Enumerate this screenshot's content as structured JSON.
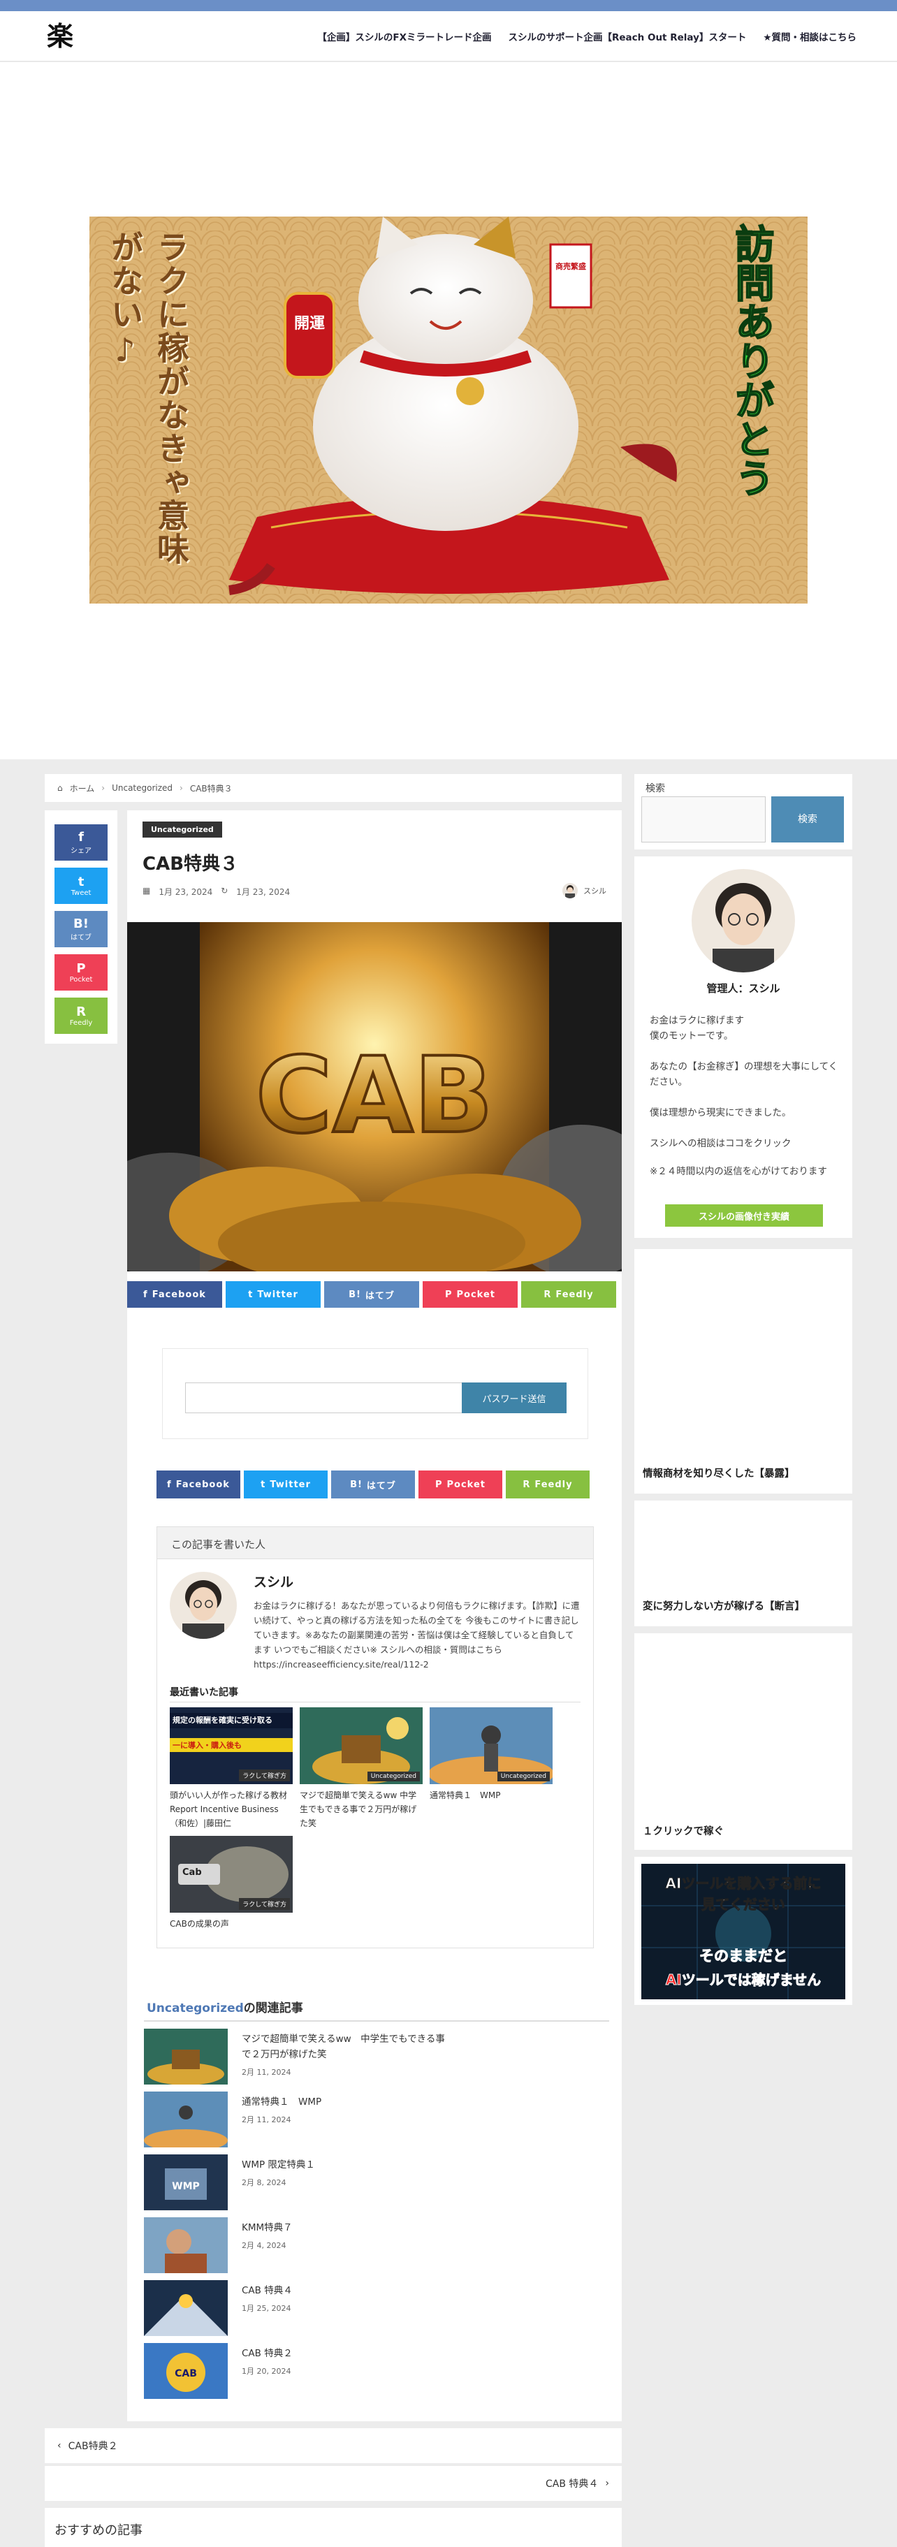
{
  "header": {
    "logo_char": "楽",
    "nav": [
      "【企画】スシルのFXミラートレード企画",
      "スシルのサポート企画【Reach Out Relay】スタート",
      "★質問・相談はこちら"
    ]
  },
  "hero": {
    "left_text": "ラクに稼がなきゃ意味がない♪",
    "right_text": "訪問ありがとう",
    "charm_left": "開運",
    "charm_right": "商売繁盛"
  },
  "breadcrumb": [
    "ホーム",
    "Uncategorized",
    "CAB特典３"
  ],
  "share_float": [
    {
      "icon": "f",
      "label": "シェア",
      "color": "#3b5998"
    },
    {
      "icon": "t",
      "label": "Tweet",
      "color": "#1da1f2"
    },
    {
      "icon": "B!",
      "label": "はてブ",
      "color": "#5d8ac1"
    },
    {
      "icon": "P",
      "label": "Pocket",
      "color": "#ef4056"
    },
    {
      "icon": "R",
      "label": "Feedly",
      "color": "#87c040"
    }
  ],
  "article": {
    "category": "Uncategorized",
    "title": "CAB特典３",
    "published": "1月 23, 2024",
    "updated": "1月 23, 2024",
    "author": "スシル",
    "eyecatch_text": "CAB"
  },
  "share_buttons": [
    "Facebook",
    "Twitter",
    "はてブ",
    "Pocket",
    "Feedly"
  ],
  "password_form": {
    "button": "パスワード送信"
  },
  "author_box": {
    "heading": "この記事を書いた人",
    "name": "スシル",
    "description": "お金はラクに稼げる！あなたが思っているより何倍もラクに稼げます。【詐欺】に遭い続けて、やっと真の稼げる方法を知った私の全てを 今後もこのサイトに書き記していきます。※あなたの副業関連の苦労・苦悩は僕は全て経験していると自負してます いつでもご相談ください※ スシルへの相談・質問はこちら https://increaseefficiency.site/real/112-2",
    "recent_heading": "最近書いた記事",
    "recent": [
      {
        "title": "頭がいい人が作った稼げる教材Report Incentive Business（和佐）|藤田仁",
        "tag": "ラクして稼ぎ方",
        "banner": "規定の報酬を確実に受け取る",
        "banner2": "一に導入・購入後も"
      },
      {
        "title": "マジで超簡単で笑えるww 中学生でもできる事で２万円が稼げた笑",
        "tag": "Uncategorized"
      },
      {
        "title": "通常特典１　WMP",
        "tag": "Uncategorized"
      },
      {
        "title": "CABの成果の声",
        "tag": "ラクして稼ぎ方",
        "logo": "Cab"
      }
    ]
  },
  "related": {
    "category": "Uncategorized",
    "suffix": "の関連記事",
    "items": [
      {
        "title": "マジで超簡単で笑えるww　中学生でもできる事で２万円が稼げた笑",
        "date": "2月 11, 2024"
      },
      {
        "title": "通常特典１　WMP",
        "date": "2月 11, 2024"
      },
      {
        "title": "WMP 限定特典１",
        "date": "2月 8, 2024",
        "label": "WMP"
      },
      {
        "title": "KMM特典７",
        "date": "2月 4, 2024"
      },
      {
        "title": "CAB 特典４",
        "date": "1月 25, 2024"
      },
      {
        "title": "CAB 特典２",
        "date": "1月 20, 2024",
        "label": "CAB"
      }
    ]
  },
  "pager": {
    "prev": "CAB特典２",
    "next": "CAB 特典４"
  },
  "recommended": "おすすめの記事",
  "sidebar": {
    "search_label": "検索",
    "search_button": "検索",
    "profile_name": "管理人：スシル",
    "profile_lines": [
      "お金はラクに稼げます",
      "僕のモットーです。",
      "あなたの【お金稼ぎ】の理想を大事にしてください。",
      "僕は理想から現実にできました。",
      "スシルへの相談はココをクリック",
      "※２４時間以内の返信を心がけております"
    ],
    "profile_button": "スシルの画像付き実績",
    "links": [
      "情報商材を知り尽くした【暴露】",
      "変に努力しない方が稼げる【断言】",
      "１クリックで稼ぐ"
    ],
    "ad_line1": "AIツールを購入する前に",
    "ad_line2": "見てください",
    "ad_line3": "そのままだと",
    "ad_line4": "AIツールでは稼げません"
  }
}
